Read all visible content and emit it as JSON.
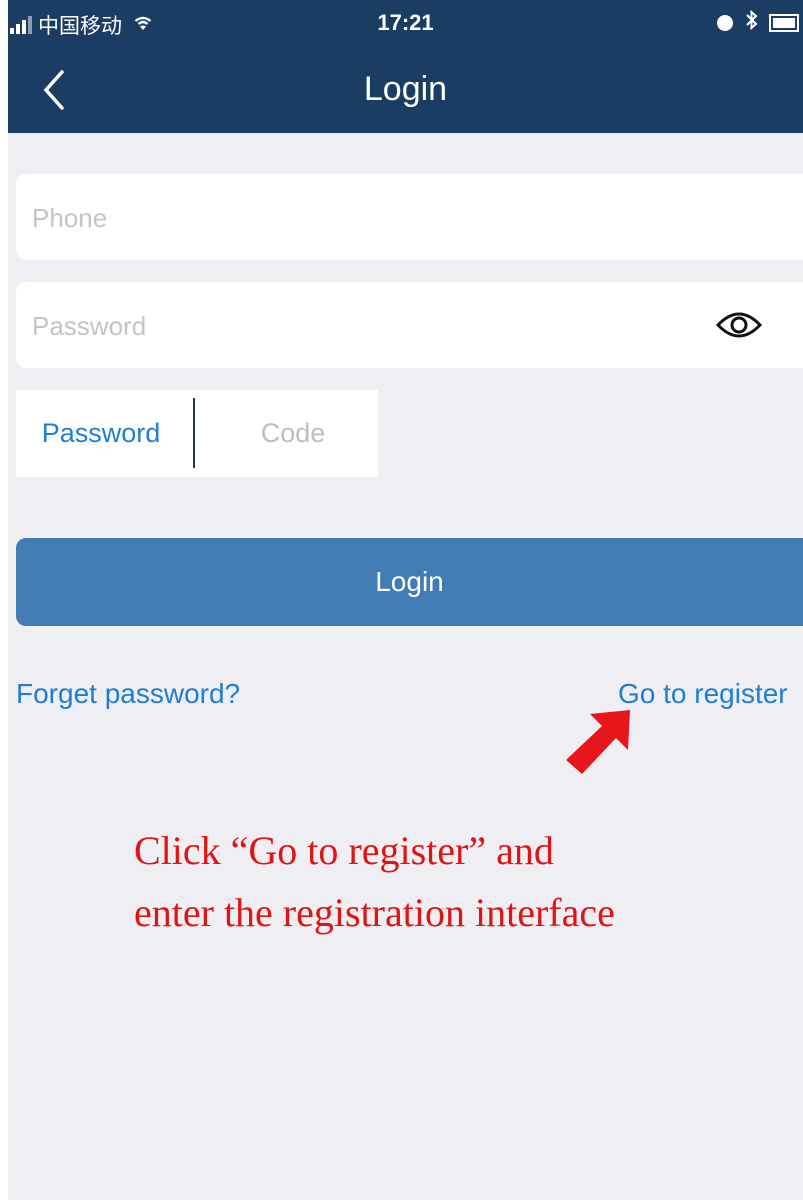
{
  "status_bar": {
    "carrier": "中国移动",
    "time": "17:21"
  },
  "nav": {
    "title": "Login"
  },
  "form": {
    "phone_placeholder": "Phone",
    "password_placeholder": "Password"
  },
  "login_mode": {
    "password_tab": "Password",
    "code_tab": "Code",
    "selected": "Password"
  },
  "login_button": "Login",
  "links": {
    "forget_password": "Forget password?",
    "go_to_register": "Go to register"
  },
  "annotation": {
    "line1": "Click “Go to register” and",
    "line2": "enter the registration interface",
    "color": "#e01414"
  },
  "colors": {
    "header": "#1c3d63",
    "accent": "#1e7ed6",
    "button": "#427cb4",
    "background": "#eeeef3"
  }
}
